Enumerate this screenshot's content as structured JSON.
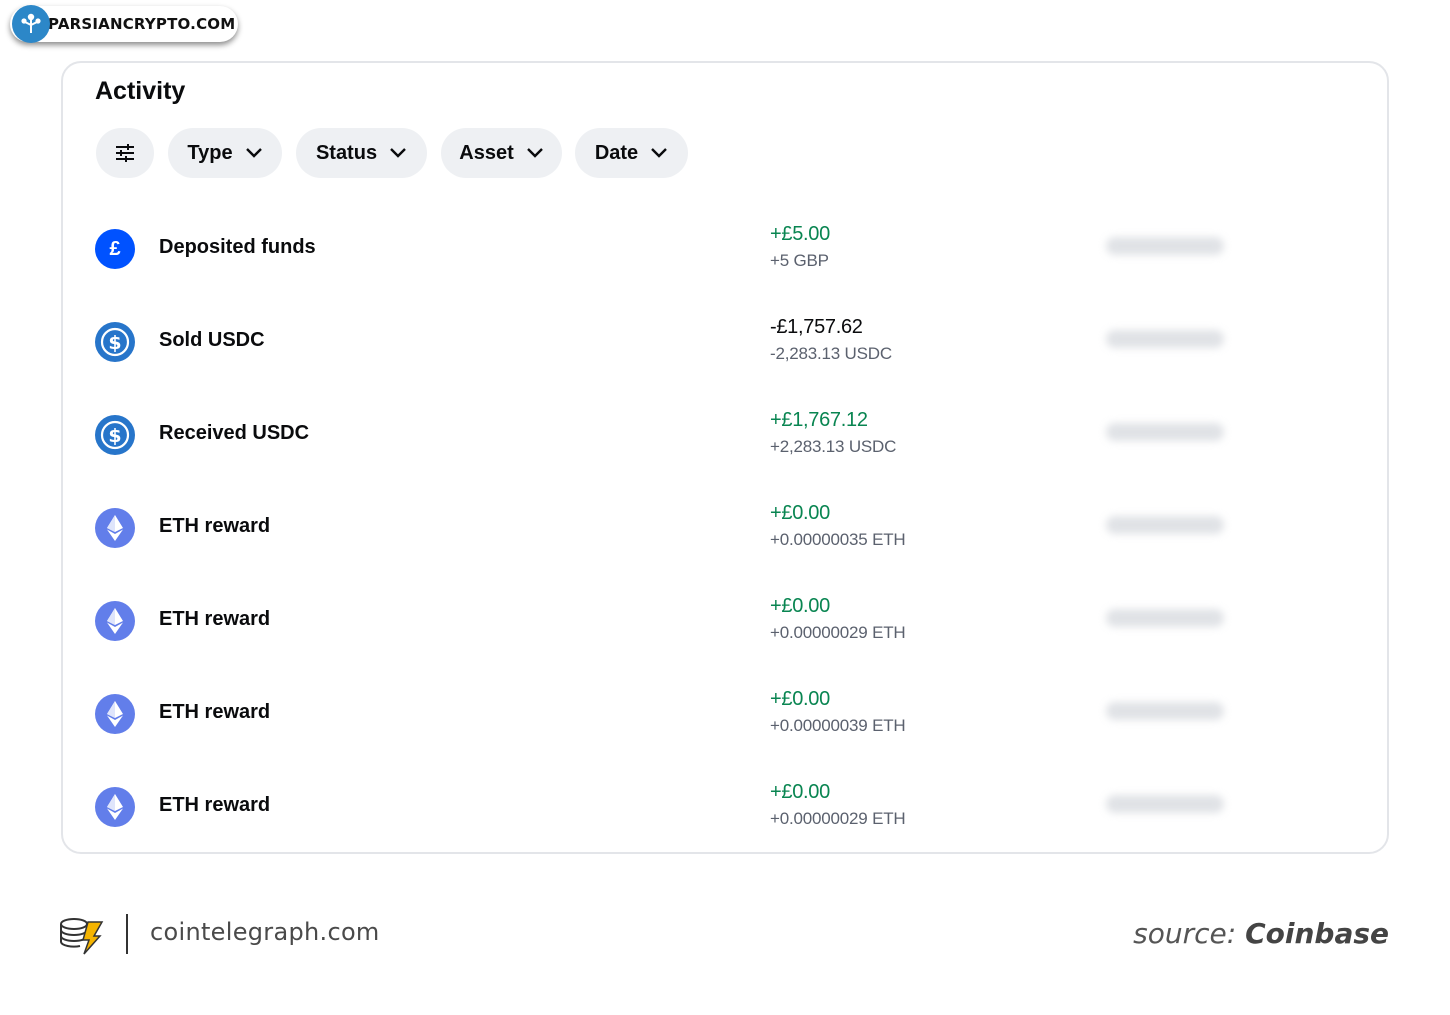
{
  "watermark": {
    "text": "PARSIANCRYPTO.COM",
    "icon": "tree-logo-icon"
  },
  "activity": {
    "title": "Activity",
    "filters": [
      {
        "label": "Type"
      },
      {
        "label": "Status"
      },
      {
        "label": "Asset"
      },
      {
        "label": "Date"
      }
    ],
    "filter_icon": "sliders-icon",
    "rows": [
      {
        "title": "Deposited funds",
        "icon": "gbp-icon",
        "amount": "+£5.00",
        "amount_sign": "positive",
        "sub": "+5 GBP"
      },
      {
        "title": "Sold USDC",
        "icon": "usdc-icon",
        "amount": "-£1,757.62",
        "amount_sign": "negative",
        "sub": "-2,283.13 USDC"
      },
      {
        "title": "Received USDC",
        "icon": "usdc-icon",
        "amount": "+£1,767.12",
        "amount_sign": "positive",
        "sub": "+2,283.13 USDC"
      },
      {
        "title": "ETH reward",
        "icon": "eth-icon",
        "amount": "+£0.00",
        "amount_sign": "positive",
        "sub": "+0.00000035 ETH"
      },
      {
        "title": "ETH reward",
        "icon": "eth-icon",
        "amount": "+£0.00",
        "amount_sign": "positive",
        "sub": "+0.00000029 ETH"
      },
      {
        "title": "ETH reward",
        "icon": "eth-icon",
        "amount": "+£0.00",
        "amount_sign": "positive",
        "sub": "+0.00000039 ETH"
      },
      {
        "title": "ETH reward",
        "icon": "eth-icon",
        "amount": "+£0.00",
        "amount_sign": "positive",
        "sub": "+0.00000029 ETH"
      }
    ]
  },
  "footer": {
    "site": "cointelegraph.com",
    "source_label": "source:",
    "source_brand": "Coinbase"
  },
  "colors": {
    "positive": "#098551",
    "coinbase_blue": "#0052ff",
    "usdc_blue": "#2775ca",
    "eth_purple": "#627eea"
  }
}
